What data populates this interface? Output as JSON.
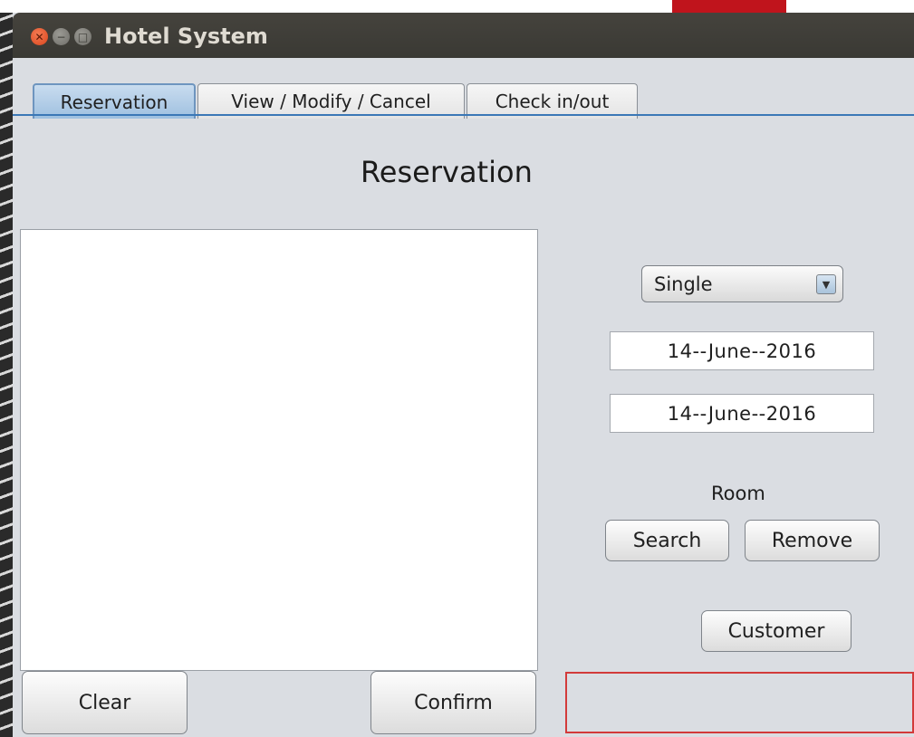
{
  "window": {
    "title": "Hotel System",
    "window_buttons": [
      "close-icon",
      "minimize-icon",
      "maximize-icon"
    ]
  },
  "tabs": [
    {
      "label": "Reservation",
      "selected": true
    },
    {
      "label": "View / Modify / Cancel",
      "selected": false
    },
    {
      "label": "Check in/out",
      "selected": false
    }
  ],
  "page": {
    "title": "Reservation"
  },
  "form": {
    "room_type_selected": "Single",
    "check_in_date": "14--June--2016",
    "check_out_date": "14--June--2016",
    "room_label": "Room",
    "search_button": "Search",
    "remove_button": "Remove",
    "customer_button": "Customer"
  },
  "footer": {
    "clear_button": "Clear",
    "confirm_button": "Confirm",
    "status_message": ""
  },
  "colors": {
    "window_bg": "#dadde2",
    "titlebar_bg": "#3a3934",
    "active_tab": "#9ec0e0",
    "tab_underline": "#3b78b6",
    "status_border": "#d23a3a"
  }
}
